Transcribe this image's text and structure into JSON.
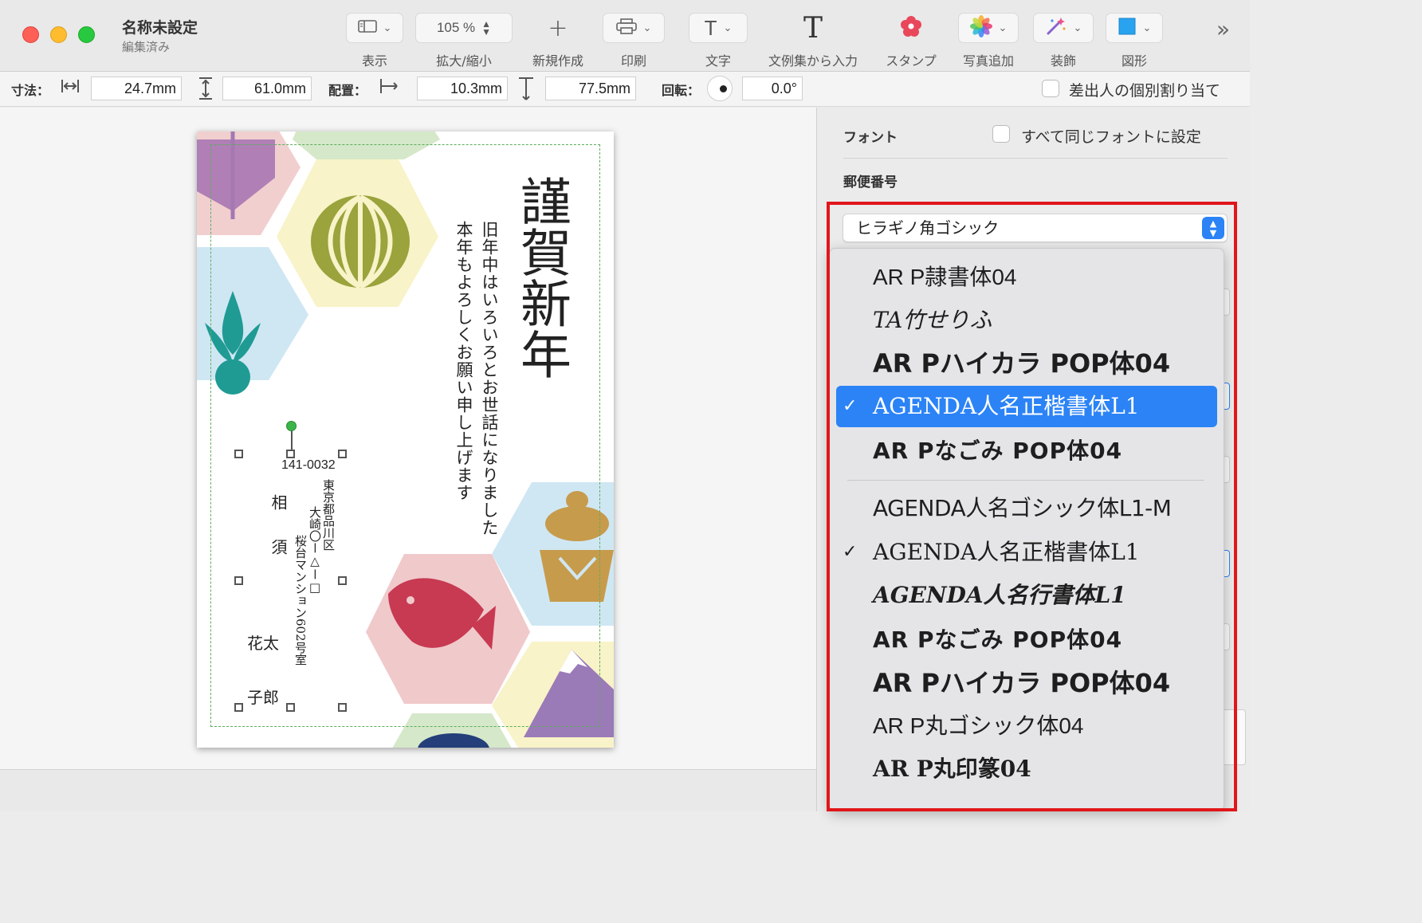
{
  "window": {
    "title": "名称未設定",
    "subtitle": "編集済み"
  },
  "toolbar": {
    "view_label": "表示",
    "zoom_value": "105 %",
    "zoom_label": "拡大/縮小",
    "new_label": "新規作成",
    "print_label": "印刷",
    "text_label": "文字",
    "phrase_label": "文例集から入力",
    "stamp_label": "スタンプ",
    "photo_label": "写真追加",
    "decor_label": "装飾",
    "shape_label": "図形"
  },
  "dimbar": {
    "size_label": "寸法：",
    "width_value": "24.7mm",
    "height_value": "61.0mm",
    "position_label": "配置：",
    "x_value": "10.3mm",
    "y_value": "77.5mm",
    "rotation_label": "回転：",
    "rotation_value": "0.0°",
    "sender_label": "差出人の個別割り当て"
  },
  "card": {
    "greeting": "謹賀新年",
    "message_line1": "旧年中はいろいろとお世話になりました",
    "message_line2": "本年もよろしくお願い申し上げます",
    "postal_code": "141-0032",
    "address_line1": "東京都品川区",
    "address_line2": "大崎〇ー△ー□",
    "address_line3": "桜台マンション602号室",
    "surname": "相須",
    "name1": "花太",
    "name2": "子郎"
  },
  "panel": {
    "font_heading": "フォント",
    "same_font_label": "すべて同じフォントに設定",
    "postal_heading": "郵便番号",
    "selected_font": "ヒラギノ角ゴシック"
  },
  "dropdown": {
    "items": [
      {
        "label": "AR P隷書体04",
        "checked": false,
        "selected": false
      },
      {
        "label": "TA竹せりふ",
        "checked": false,
        "selected": false
      },
      {
        "label": "AR Pハイカラ POP体04",
        "checked": false,
        "selected": false
      },
      {
        "label": "AGENDA人名正楷書体L1",
        "checked": true,
        "selected": true
      },
      {
        "label": "AR Pなごみ POP体04",
        "checked": false,
        "selected": false
      },
      {
        "label": "AGENDA人名ゴシック体L1-M",
        "checked": false,
        "selected": false
      },
      {
        "label": "AGENDA人名正楷書体L1",
        "checked": true,
        "selected": false
      },
      {
        "label": "AGENDA人名行書体L1",
        "checked": false,
        "selected": false
      },
      {
        "label": "AR Pなごみ POP体04",
        "checked": false,
        "selected": false
      },
      {
        "label": "AR Pハイカラ POP体04",
        "checked": false,
        "selected": false
      },
      {
        "label": "AR P丸ゴシック体04",
        "checked": false,
        "selected": false
      },
      {
        "label": "AR P丸印篆04",
        "checked": false,
        "selected": false
      }
    ],
    "check_mark": "✓"
  },
  "colors": {
    "accent": "#2b83f6",
    "highlight_border": "#e0161a"
  }
}
